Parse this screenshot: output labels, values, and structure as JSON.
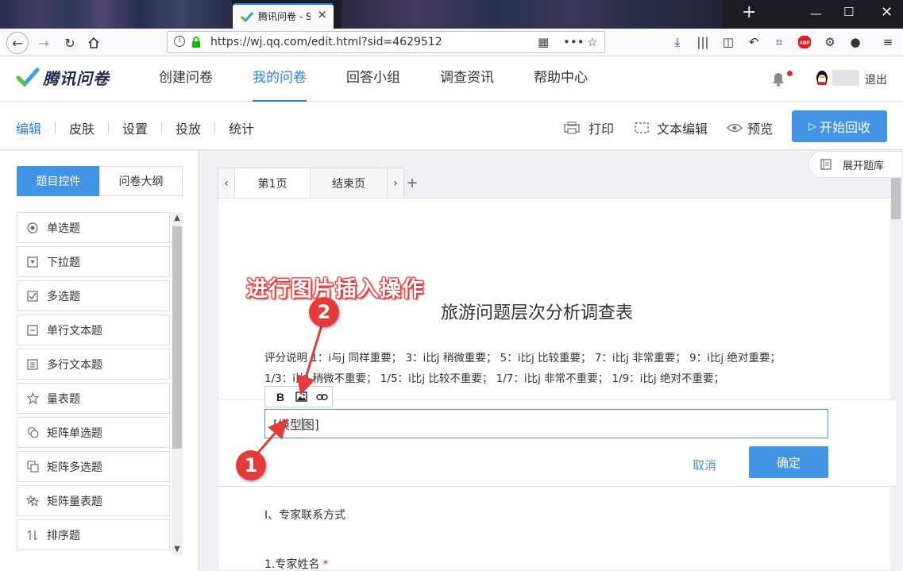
{
  "browser": {
    "tab_title": "腾讯问卷 - S",
    "url": "https://wj.qq.com/edit.html?sid=4629512"
  },
  "header": {
    "logo_text": "腾讯问卷",
    "nav": [
      "创建问卷",
      "我的问卷",
      "回答小组",
      "调查资讯",
      "帮助中心"
    ],
    "active_nav": "我的问卷",
    "logout": "退出"
  },
  "subbar": {
    "tabs": [
      "编辑",
      "皮肤",
      "设置",
      "投放",
      "统计"
    ],
    "active_tab": "编辑",
    "print": "打印",
    "text_edit": "文本编辑",
    "preview": "预览",
    "start": "开始回收"
  },
  "left_panel": {
    "tab_controls": "题目控件",
    "tab_outline": "问卷大纲",
    "items": [
      {
        "label": "单选题",
        "icon": "radio-icon"
      },
      {
        "label": "下拉题",
        "icon": "dropdown-icon"
      },
      {
        "label": "多选题",
        "icon": "checkbox-icon"
      },
      {
        "label": "单行文本题",
        "icon": "single-line-icon"
      },
      {
        "label": "多行文本题",
        "icon": "multi-line-icon"
      },
      {
        "label": "量表题",
        "icon": "star-icon"
      },
      {
        "label": "矩阵单选题",
        "icon": "matrix-radio-icon"
      },
      {
        "label": "矩阵多选题",
        "icon": "matrix-check-icon"
      },
      {
        "label": "矩阵量表题",
        "icon": "matrix-star-icon"
      },
      {
        "label": "排序题",
        "icon": "sort-icon"
      }
    ]
  },
  "editor": {
    "expand_library": "展开题库",
    "page_tabs": [
      "第1页",
      "结束页"
    ],
    "survey_title": "旅游问题层次分析调查表",
    "score_line1": "评分说明    1：i与j 同样重要；  3：i比j 稍微重要；  5：i比j 比较重要；  7：i比j 非常重要；  9：i比j 绝对重要；",
    "score_line2": "1/3：i比j 稍微不重要；  1/5：i比j 比较不重要；  1/7：i比j 非常不重要；  1/9：i比j 绝对不重要；",
    "input_before_caret": "[模型",
    "input_after_caret": "图]",
    "cancel": "取消",
    "confirm": "确定",
    "section_title": "I、专家联系方式",
    "field_label": "1.专家姓名",
    "required_mark": "*"
  },
  "annotation": {
    "callout": "进行图片插入操作",
    "badge1": "1",
    "badge2": "2"
  },
  "colors": {
    "accent": "#4295e5",
    "link": "#2b7fe0",
    "annotation_red": "#e43a3a"
  }
}
